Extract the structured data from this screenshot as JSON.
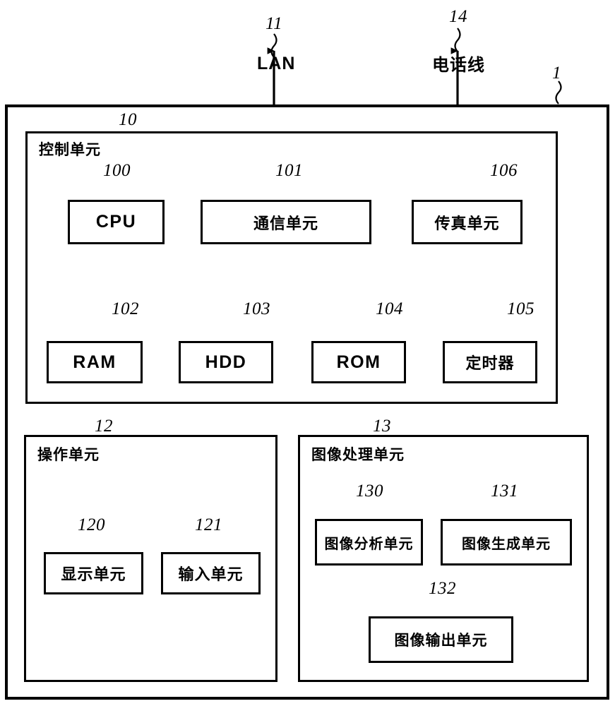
{
  "figure": {
    "device_ref": "1",
    "terminals": [
      {
        "name": "lan",
        "ref": "11",
        "label": "LAN"
      },
      {
        "name": "telephone",
        "ref": "14",
        "label": "电话线"
      }
    ],
    "units": [
      {
        "name": "control-unit",
        "ref": "10",
        "title": "控制单元",
        "blocks": [
          {
            "name": "cpu",
            "ref": "100",
            "label": "CPU",
            "script": "latin"
          },
          {
            "name": "communication-unit",
            "ref": "101",
            "label": "通信单元",
            "script": "cjk"
          },
          {
            "name": "fax-unit",
            "ref": "106",
            "label": "传真单元",
            "script": "cjk"
          },
          {
            "name": "ram",
            "ref": "102",
            "label": "RAM",
            "script": "latin"
          },
          {
            "name": "hdd",
            "ref": "103",
            "label": "HDD",
            "script": "latin"
          },
          {
            "name": "rom",
            "ref": "104",
            "label": "ROM",
            "script": "latin"
          },
          {
            "name": "timer",
            "ref": "105",
            "label": "定时器",
            "script": "cjk"
          }
        ]
      },
      {
        "name": "operation-unit",
        "ref": "12",
        "title": "操作单元",
        "blocks": [
          {
            "name": "display-unit",
            "ref": "120",
            "label": "显示单元",
            "script": "cjk"
          },
          {
            "name": "input-unit",
            "ref": "121",
            "label": "输入单元",
            "script": "cjk"
          }
        ]
      },
      {
        "name": "image-processing-unit",
        "ref": "13",
        "title": "图像处理单元",
        "blocks": [
          {
            "name": "image-analysis-unit",
            "ref": "130",
            "label": "图像分析单元",
            "script": "cjk"
          },
          {
            "name": "image-generation-unit",
            "ref": "131",
            "label": "图像生成单元",
            "script": "cjk"
          },
          {
            "name": "image-output-unit",
            "ref": "132",
            "label": "图像输出单元",
            "script": "cjk"
          }
        ]
      }
    ],
    "colors": {
      "line": "#000000",
      "background": "#ffffff"
    }
  }
}
